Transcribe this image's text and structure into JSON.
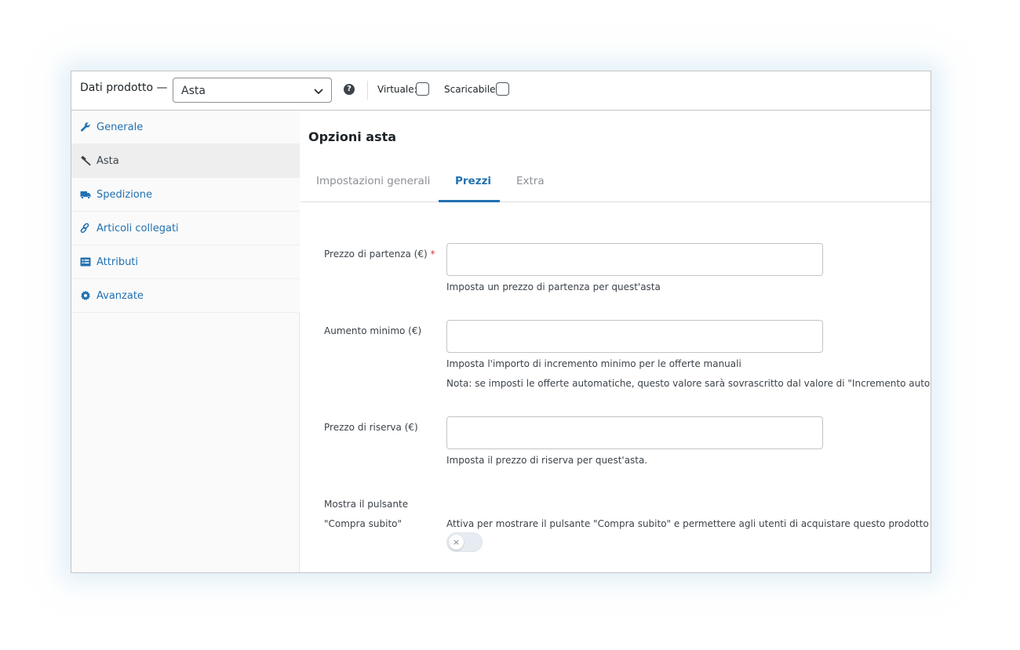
{
  "header": {
    "title": "Dati prodotto —",
    "product_type": "Asta",
    "help_icon": "help-icon",
    "virtual_label": "Virtuale:",
    "virtual_checked": false,
    "downloadable_label": "Scaricabile:",
    "downloadable_checked": false
  },
  "sidebar": {
    "items": [
      {
        "label": "Generale",
        "icon": "wrench-icon",
        "active": false
      },
      {
        "label": "Asta",
        "icon": "gavel-icon",
        "active": true
      },
      {
        "label": "Spedizione",
        "icon": "truck-icon",
        "active": false
      },
      {
        "label": "Articoli collegati",
        "icon": "link-icon",
        "active": false
      },
      {
        "label": "Attributi",
        "icon": "list-icon",
        "active": false
      },
      {
        "label": "Avanzate",
        "icon": "gear-icon",
        "active": false
      }
    ]
  },
  "main": {
    "title": "Opzioni asta",
    "tabs": [
      {
        "label": "Impostazioni generali",
        "active": false
      },
      {
        "label": "Prezzi",
        "active": true
      },
      {
        "label": "Extra",
        "active": false
      }
    ],
    "fields": {
      "start_price": {
        "label": "Prezzo di partenza (€)",
        "required_mark": "*",
        "value": "",
        "help": "Imposta un prezzo di partenza per quest'asta"
      },
      "min_increment": {
        "label": "Aumento minimo (€)",
        "value": "",
        "help": "Imposta l'importo di incremento minimo per le offerte manuali",
        "note": "Nota: se imposti le offerte automatiche, questo valore sarà sovrascritto dal valore di \"Incremento automatico\"."
      },
      "reserve_price": {
        "label": "Prezzo di riserva (€)",
        "value": "",
        "help": "Imposta il prezzo di riserva per quest'asta."
      },
      "buy_now": {
        "label_line1": "Mostra il pulsante",
        "label_line2": "\"Compra subito\"",
        "enabled": false,
        "toggle_symbol": "×",
        "help": "Attiva per mostrare il pulsante \"Compra subito\" e permettere agli utenti di acquistare questo prodotto senza fare un'offerta"
      }
    }
  },
  "colors": {
    "link_blue": "#2271b1",
    "border": "#c3c4c7",
    "required_red": "#d63638",
    "sidebar_bg": "#fafafa",
    "sidebar_active_bg": "#eeeeee"
  }
}
